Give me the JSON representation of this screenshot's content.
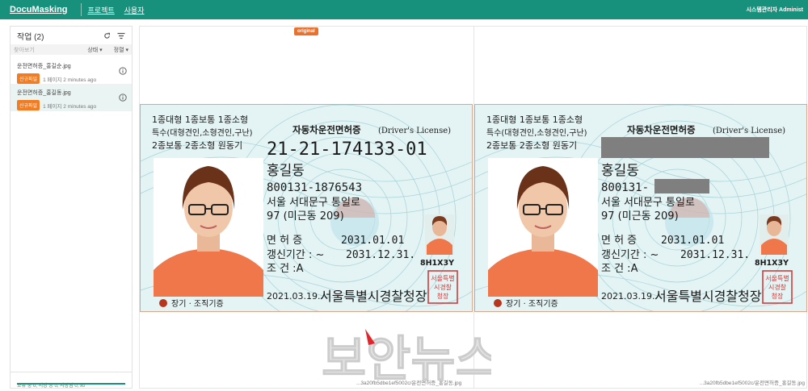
{
  "header": {
    "brand": "DocuMasking",
    "nav": [
      "프로젝트",
      "사용자"
    ],
    "user": "시스템관리자 Administ"
  },
  "sidebar": {
    "title": "작업 (2)",
    "search_placeholder": "찾아보기",
    "status_label": "상태",
    "sort_label": "정렬",
    "jobs": [
      {
        "name": "운전면허증_홍길순.jpg",
        "badge": "신규파일",
        "meta": "1 페이지 2 minutes ago"
      },
      {
        "name": "운전면허증_홍길동.jpg",
        "badge": "신규파일",
        "meta": "1 페이지 2 minutes ago"
      }
    ],
    "footer": "보류 중 0, 저장 중 0, 저장됨 0, x0",
    "progress": 1.0
  },
  "viewer": {
    "original_chip": "original",
    "left_caption": "...3a20fb5dbe1ef5002c/운전면허증_홍길동.jpg",
    "right_caption": "...3a20fb5dbe1ef5002c/운전면허증_홍길동.jpg"
  },
  "license": {
    "types1": "1종대형  1종보통  1종소형",
    "types2": "특수(대형견인,소형견인,구난)",
    "types3": "2종보통 2종소형  원동기",
    "title": "자동차운전면허증",
    "title_en": "(Driver's License)",
    "number": "21-21-174133-01",
    "name": "홍길동",
    "rrn": "800131-1876543",
    "rrn_masked": "800131-",
    "address1": "서울 서대문구 통일로",
    "address2": "97 (미근동 209)",
    "renew_label": "면 허 증",
    "renew_date": "2031.01.01",
    "period_label": "갱신기간 : ~",
    "period_date": "2031.12.31.",
    "cond_label": "조    건 :A",
    "serial": "8H1X3Y",
    "issue_date": "2021.03.19.",
    "issuer": "서울특별시경찰청장",
    "seal1": "서울특별",
    "seal2": "시경찰",
    "seal3": "청장",
    "donor": "장기 · 조직기증"
  },
  "colors": {
    "accent": "#17907c",
    "badge": "#f07c24",
    "mask": "#7f7f7f"
  },
  "watermark": "보안뉴스"
}
